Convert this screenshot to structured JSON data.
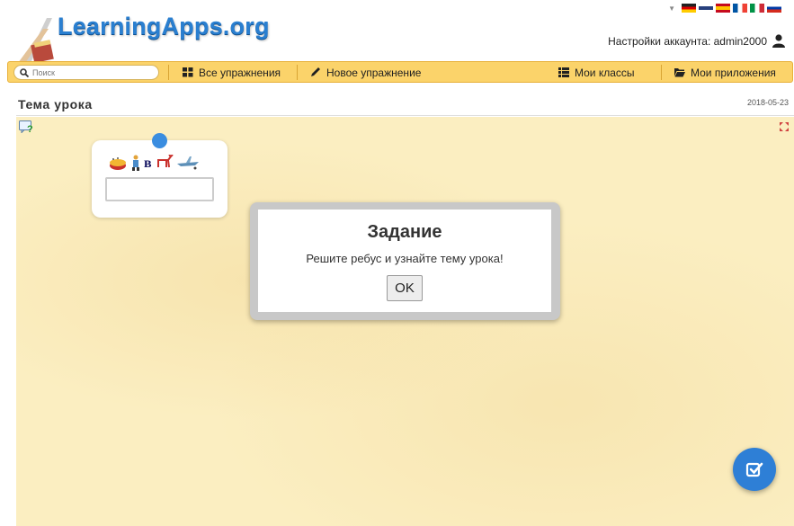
{
  "site": {
    "logo_text": "LearningApps.org"
  },
  "account": {
    "label": "Настройки аккаунта: admin2000"
  },
  "search": {
    "placeholder": "Поиск"
  },
  "nav": {
    "all_exercises": "Все упражнения",
    "new_exercise": "Новое упражнение",
    "my_classes": "Мои классы",
    "my_apps": "Мои приложения"
  },
  "page": {
    "title": "Тема урока",
    "date": "2018-05-23"
  },
  "dialog": {
    "title": "Задание",
    "message": "Решите ребус и узнайте тему урока!",
    "ok_label": "OK"
  },
  "answer": {
    "value": ""
  },
  "colors": {
    "accent": "#2e7fd6",
    "nav_bar": "#fbd36a",
    "app_background": "#fbeec1"
  },
  "icons": [
    "search-icon",
    "grid-icon",
    "pencil-icon",
    "list-icon",
    "folder-icon",
    "user-icon",
    "help-icon",
    "expand-icon",
    "check-icon"
  ]
}
